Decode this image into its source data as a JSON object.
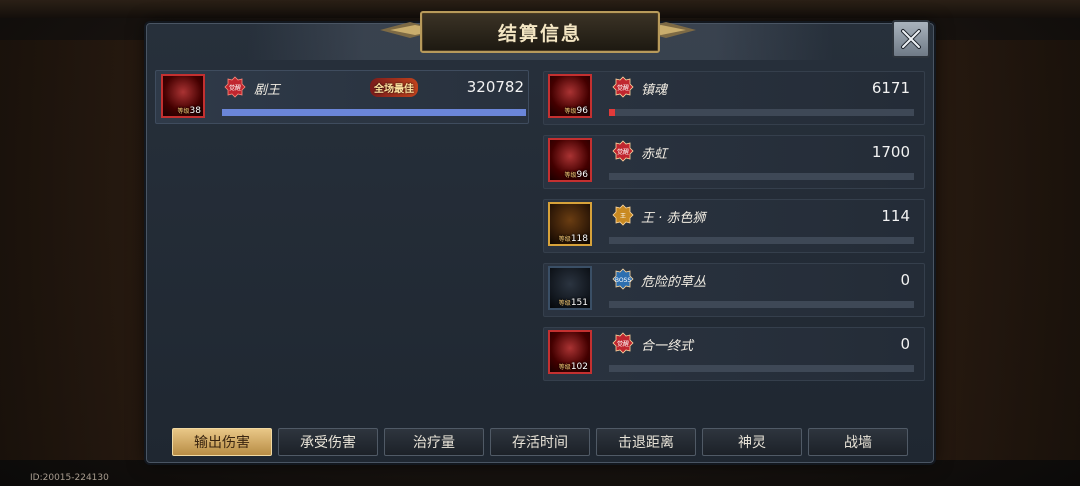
{
  "screen": {
    "title": "结算信息",
    "footer_id": "ID:20015-224130",
    "level_prefix": "等级"
  },
  "mvp": {
    "player": {
      "name": "剧王",
      "level": "38",
      "value": "320782",
      "bar": 1.0,
      "badge": "觉醒",
      "mvp_label": "全场最佳"
    }
  },
  "opponents": [
    {
      "name": "镇魂",
      "level": "96",
      "value": "6171",
      "bar": 0.02,
      "badge": "觉醒",
      "avatar_style": "red"
    },
    {
      "name": "赤虹",
      "level": "96",
      "value": "1700",
      "bar": 0.0,
      "badge": "觉醒",
      "avatar_style": "red"
    },
    {
      "name": "王 · 赤色狮",
      "level": "118",
      "value": "114",
      "bar": 0.0,
      "badge": "王",
      "avatar_style": "gold"
    },
    {
      "name": "危险的草丛",
      "level": "151",
      "value": "0",
      "bar": 0.0,
      "badge": "BOSS",
      "avatar_style": "blue"
    },
    {
      "name": "合一终式",
      "level": "102",
      "value": "0",
      "bar": 0.0,
      "badge": "觉醒",
      "avatar_style": "red"
    }
  ],
  "tabs": [
    "输出伤害",
    "承受伤害",
    "治疗量",
    "存活时间",
    "击退距离",
    "神灵",
    "战墙"
  ],
  "active_tab": "输出伤害",
  "colors": {
    "mvp_bar": "#6b86d9",
    "enemy_bar": "#e23a3a",
    "active_tab": "#e2bd78"
  },
  "icons": {
    "close": "close-icon",
    "badge": "awaken-badge-icon",
    "mvp": "flame-badge-icon"
  }
}
